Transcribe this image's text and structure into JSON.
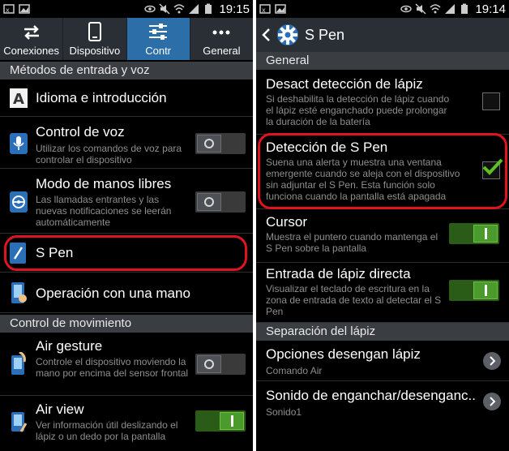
{
  "left": {
    "status": {
      "time": "19:15"
    },
    "tabs": [
      {
        "label": "Conexiones",
        "icon": "swap-arrows-icon"
      },
      {
        "label": "Dispositivo",
        "icon": "phone-icon"
      },
      {
        "label": "Contr",
        "icon": "sliders-icon",
        "active": true
      },
      {
        "label": "General",
        "icon": "more-dots-icon"
      }
    ],
    "section_input": "Métodos de entrada y voz",
    "items": {
      "language": {
        "title": "Idioma e introducción"
      },
      "voice": {
        "title": "Control de voz",
        "summary": "Utilizar los comandos de voz para controlar el dispositivo",
        "toggle": false
      },
      "handsfree": {
        "title": "Modo de manos libres",
        "summary": "Las llamadas entrantes y las nuevas notificaciones se leerán automáticamente",
        "toggle": false
      },
      "spen": {
        "title": "S Pen"
      },
      "onehand": {
        "title": "Operación con una mano"
      }
    },
    "section_motion": "Control de movimiento",
    "motion": {
      "airgesture": {
        "title": "Air gesture",
        "summary": "Controle el dispositivo moviendo la mano por encima del sensor frontal",
        "toggle": false
      },
      "airview": {
        "title": "Air view",
        "summary": "Ver información útil deslizando el lápiz o un dedo por la pantalla",
        "toggle": true
      }
    }
  },
  "right": {
    "status": {
      "time": "19:14"
    },
    "title": "S Pen",
    "section_general": "General",
    "items": {
      "disable": {
        "title": "Desact detección de lápiz",
        "summary": "Si deshabilita la detección de lápiz cuando el lápiz esté enganchado puede prolongar la duración de la batería",
        "checked": false
      },
      "detect": {
        "title": "Detección de S Pen",
        "summary": "Suena una alerta y muestra una ventana emergente cuando se aleja con el dispositivo sin adjuntar el S Pen. Esta función solo funciona cuando la pantalla está apagada",
        "checked": true
      },
      "cursor": {
        "title": "Cursor",
        "summary": "Muestra el puntero cuando mantenga el S Pen sobre la pantalla",
        "toggle": true
      },
      "direct": {
        "title": "Entrada de lápiz directa",
        "summary": "Visualizar el teclado de escritura en la zona de entrada de texto al detectar el S Pen",
        "toggle": true
      }
    },
    "section_detach": "Separación del lápiz",
    "detach": {
      "options": {
        "title": "Opciones desengan lápiz",
        "summary": "Comando Air"
      },
      "sound": {
        "title": "Sonido de enganchar/desenganc..",
        "summary": "Sonido1"
      }
    }
  }
}
